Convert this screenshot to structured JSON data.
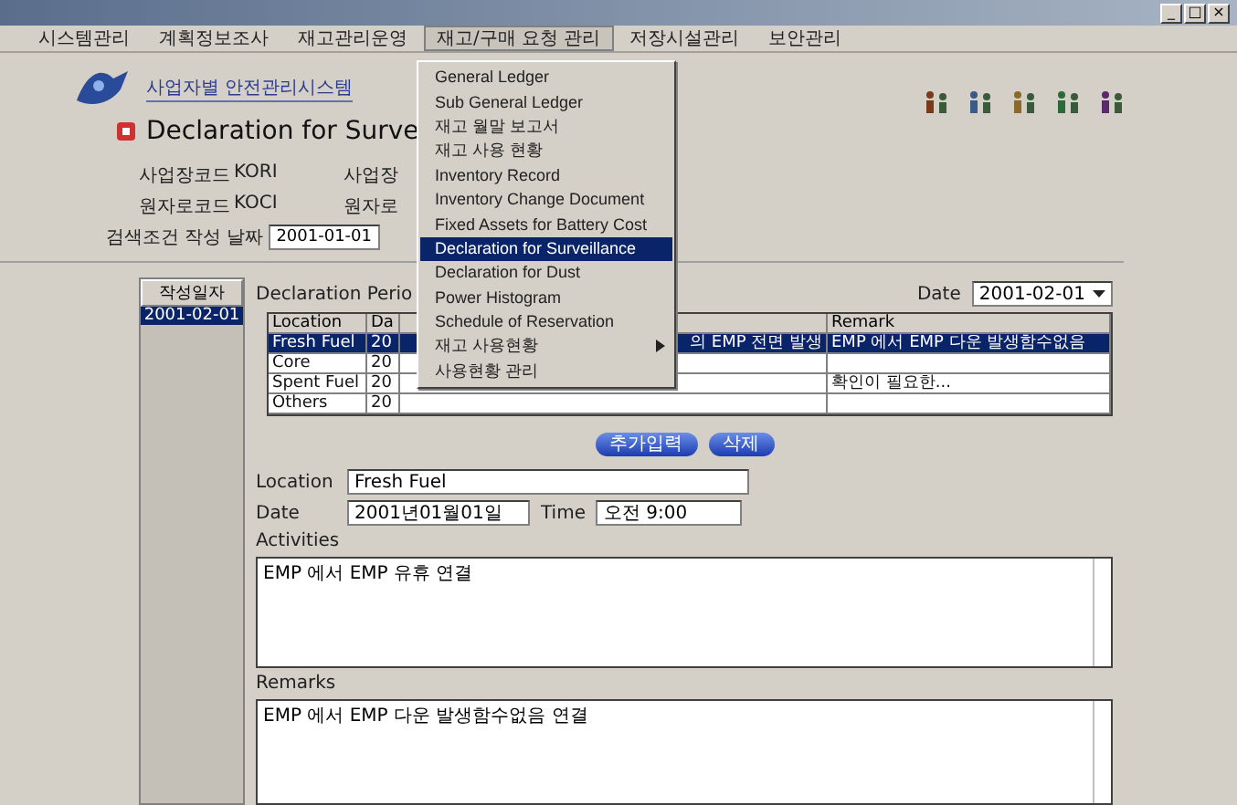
{
  "window": {
    "controls": [
      "_",
      "□",
      "×"
    ]
  },
  "menu_bar": [
    {
      "label": "시스템관리",
      "open": false
    },
    {
      "label": "계획정보조사",
      "open": false
    },
    {
      "label": "재고관리운영",
      "open": false
    },
    {
      "label": "재고/구매 요청 관리",
      "open": true
    },
    {
      "label": "저장시설관리",
      "open": false
    },
    {
      "label": "보안관리",
      "open": false
    }
  ],
  "open_menu": {
    "items": [
      {
        "label": "General Ledger",
        "selected": false,
        "submenu": false
      },
      {
        "label": "Sub General Ledger",
        "selected": false,
        "submenu": false
      },
      {
        "label": "재고 월말 보고서",
        "selected": false,
        "submenu": false
      },
      {
        "label": "재고 사용 현황",
        "selected": false,
        "submenu": false
      },
      {
        "label": "Inventory Record",
        "selected": false,
        "submenu": false
      },
      {
        "label": "Inventory Change Document",
        "selected": false,
        "submenu": false
      },
      {
        "label": "Fixed Assets for Battery Cost",
        "selected": false,
        "submenu": false
      },
      {
        "label": "Declaration for Surveillance",
        "selected": true,
        "submenu": false
      },
      {
        "label": "Declaration for Dust",
        "selected": false,
        "submenu": false
      },
      {
        "label": "Power Histogram",
        "selected": false,
        "submenu": false
      },
      {
        "label": "Schedule of Reservation",
        "selected": false,
        "submenu": false
      },
      {
        "label": "재고 사용현황",
        "selected": false,
        "submenu": true
      },
      {
        "label": "사용현황 관리",
        "selected": false,
        "submenu": false
      }
    ]
  },
  "header": {
    "subtitle": "사업자별 안전관리시스템",
    "title": "Declaration for Surve"
  },
  "info": [
    {
      "label": "사업장코드",
      "value": "KORI",
      "label2": "사업장"
    },
    {
      "label": "원자로코드",
      "value": "KOCI",
      "label2": "원자로"
    }
  ],
  "search": {
    "label": "검색조건",
    "date_label": "작성 날짜",
    "date": "2001-01-01"
  },
  "date_list": {
    "header": "작성일자",
    "items": [
      {
        "label": "2001-02-01",
        "selected": true
      }
    ]
  },
  "declaration": {
    "label": "Declaration Perio",
    "date_label": "Date",
    "date": "2001-02-01"
  },
  "table": {
    "columns": [
      {
        "label": "Location"
      },
      {
        "label": "Da"
      },
      {},
      {
        "label": "Remark"
      }
    ],
    "rows": [
      {
        "cells": [
          "Fresh Fuel",
          "20",
          "의 EMP 전면 발생",
          "EMP 에서 EMP 다운 발생함수없음"
        ],
        "selected": true
      },
      {
        "cells": [
          "Core",
          "20"
        ],
        "selected": false
      },
      {
        "cells": [
          "Spent Fuel",
          "20",
          "",
          "확인이 필요한..."
        ],
        "selected": false
      },
      {
        "cells": [
          "Others",
          "20"
        ],
        "selected": false
      }
    ]
  },
  "buttons": [
    "추가입력",
    "삭제"
  ],
  "form": {
    "location_label": "Location",
    "location": "Fresh Fuel",
    "date_label": "Date",
    "date": "2001년01월01일",
    "time_label": "Time",
    "time": "오전 9:00",
    "activities_label": "Activities",
    "activities": "EMP 에서 EMP 유휴 연결",
    "remarks_label": "Remarks",
    "remarks": "EMP 에서 EMP 다운 발생함수없음 연결"
  }
}
